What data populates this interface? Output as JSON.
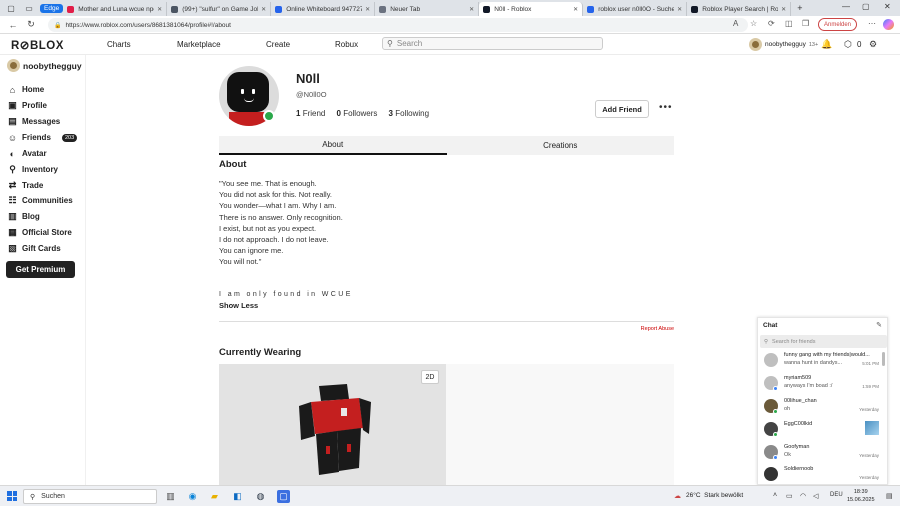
{
  "browser": {
    "edge_label": "Edge",
    "tabs": [
      {
        "title": "Mother and Luna wcue npc ed",
        "color": "#e11d48"
      },
      {
        "title": "(99+) \"sulfur\" on Game Jolt",
        "color": "#4b5563"
      },
      {
        "title": "Online Whiteboard 94772774",
        "color": "#2563eb"
      },
      {
        "title": "Neuer Tab",
        "color": "#6b7280"
      },
      {
        "title": "N0ll - Roblox",
        "color": "#111827"
      },
      {
        "title": "roblox user n0ll0O - Suchen",
        "color": "#2563eb"
      },
      {
        "title": "Roblox Player Search | Rolimo",
        "color": "#111827"
      }
    ],
    "url": "https://www.roblox.com/users/8681381064/profile#!/about",
    "signin_label": "Anmelden"
  },
  "header": {
    "logo": "R⊘BLOX",
    "nav": [
      "Charts",
      "Marketplace",
      "Create",
      "Robux"
    ],
    "search_placeholder": "Search",
    "username": "noobythegguy",
    "age_tag": "13+",
    "robux_count": "0"
  },
  "sidebar": {
    "username": "noobythegguy",
    "items": [
      {
        "label": "Home",
        "icon": "home-icon",
        "glyph": "⌂"
      },
      {
        "label": "Profile",
        "icon": "profile-icon",
        "glyph": "▣"
      },
      {
        "label": "Messages",
        "icon": "messages-icon",
        "glyph": "▤"
      },
      {
        "label": "Friends",
        "icon": "friends-icon",
        "glyph": "☺"
      },
      {
        "label": "Avatar",
        "icon": "avatar-icon",
        "glyph": "◐"
      },
      {
        "label": "Inventory",
        "icon": "inventory-icon",
        "glyph": "⚲"
      },
      {
        "label": "Trade",
        "icon": "trade-icon",
        "glyph": "⇄"
      },
      {
        "label": "Communities",
        "icon": "communities-icon",
        "glyph": "☷"
      },
      {
        "label": "Blog",
        "icon": "blog-icon",
        "glyph": "▥"
      },
      {
        "label": "Official Store",
        "icon": "store-icon",
        "glyph": "▦"
      },
      {
        "label": "Gift Cards",
        "icon": "gift-card-icon",
        "glyph": "▧"
      }
    ],
    "friends_badge": "203",
    "premium_label": "Get Premium"
  },
  "profile": {
    "display_name": "N0ll",
    "username": "@N0ll0O",
    "friends_count": "1",
    "friends_label": "Friend",
    "followers_count": "0",
    "followers_label": "Followers",
    "following_count": "3",
    "following_label": "Following",
    "add_friend_label": "Add Friend",
    "more_label": "•••",
    "tabs": [
      "About",
      "Creations"
    ],
    "about_heading": "About",
    "bio_lines": [
      "\"You see me. That is enough.",
      "You did not ask for this. Not really.",
      "You wonder—what I am. Why I am.",
      "There is no answer. Only recognition.",
      "I exist, but not as you expect.",
      "I do not approach. I do not leave.",
      "You can ignore me.",
      "You will not.\""
    ],
    "spaced_line": "I am only found in WCUE",
    "show_less": "Show Less",
    "report_abuse": "Report Abuse",
    "currently_wearing": "Currently Wearing",
    "view_2d": "2D"
  },
  "chat": {
    "title": "Chat",
    "search_placeholder": "Search for friends",
    "items": [
      {
        "name": "funny gang with my friends|would...",
        "msg": "wanna hunt in dandys...",
        "time": "5:01 PM"
      },
      {
        "name": "myriam509",
        "msg": "anyways I'm boad :/",
        "time": "1:59 PM"
      },
      {
        "name": "00lihue_chan",
        "msg": "oh",
        "time": "Yesterday"
      },
      {
        "name": "EggC00lkid",
        "msg": "",
        "time": ""
      },
      {
        "name": "Goofyman",
        "msg": "Ok",
        "time": "Yesterday"
      },
      {
        "name": "Soldiernoob",
        "msg": "",
        "time": "Yesterday"
      }
    ]
  },
  "taskbar": {
    "search_label": "Suchen",
    "temperature": "26°C",
    "weather": "Stark bewölkt",
    "language": "DEU",
    "time": "18:39",
    "date": "15.06.2025"
  }
}
